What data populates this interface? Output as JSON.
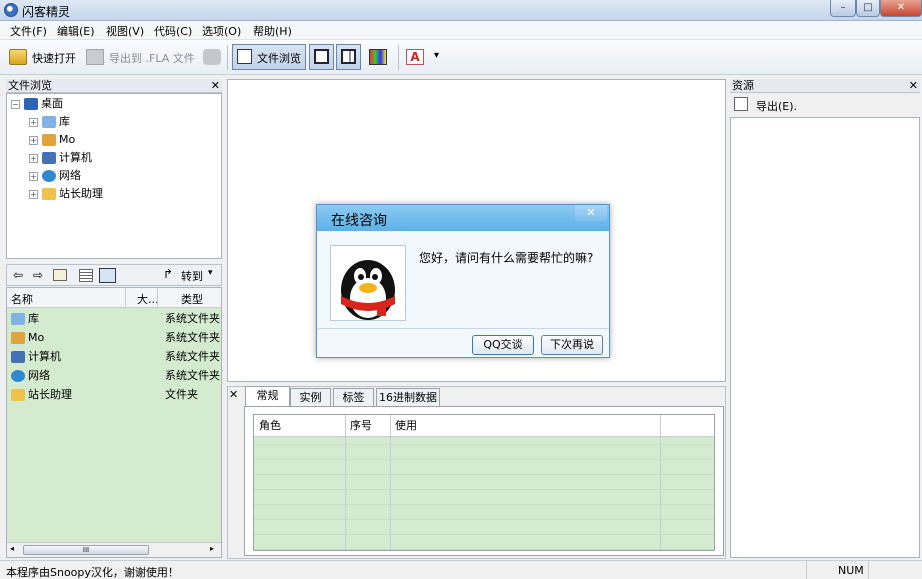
{
  "window": {
    "title": "闪客精灵",
    "controls": {
      "minimize": "–",
      "maximize": "□",
      "close": "✕"
    }
  },
  "menu": [
    "文件(F)",
    "编辑(E)",
    "视图(V)",
    "代码(C)",
    "选项(O)",
    "帮助(H)"
  ],
  "toolbar": {
    "quick_open": "快速打开",
    "export_fla": "导出到 .FLA 文件",
    "file_browse": "文件浏览",
    "dropdown_arrow": "▾"
  },
  "file_browser": {
    "title": "文件浏览",
    "close": "✕",
    "tree": {
      "root": "桌面",
      "items": [
        {
          "label": "库",
          "icon": "library-icon"
        },
        {
          "label": "Mo",
          "icon": "user-folder-icon"
        },
        {
          "label": "计算机",
          "icon": "computer-icon"
        },
        {
          "label": "网络",
          "icon": "network-icon"
        },
        {
          "label": "站长助理",
          "icon": "folder-icon"
        }
      ]
    },
    "nav": {
      "goto": "转到",
      "goto_arrow": "▾"
    },
    "columns": [
      "名称",
      "大...",
      "类型"
    ],
    "files": [
      {
        "name": "库",
        "type": "系统文件夹",
        "icon": "library-icon"
      },
      {
        "name": "Mo",
        "type": "系统文件夹",
        "icon": "user-folder-icon"
      },
      {
        "name": "计算机",
        "type": "系统文件夹",
        "icon": "computer-icon"
      },
      {
        "name": "网络",
        "type": "系统文件夹",
        "icon": "network-icon"
      },
      {
        "name": "站长助理",
        "type": "文件夹",
        "icon": "folder-icon"
      }
    ],
    "hscroll_thumb": "III"
  },
  "resources": {
    "title": "资源",
    "close": "✕",
    "export": "导出(E)."
  },
  "dialog": {
    "title": "在线咨询",
    "close": "✕",
    "message": "您好，请问有什么需要帮忙的嘛?",
    "ok_button": "QQ交谈",
    "later_button": "下次再说"
  },
  "bottom_panel": {
    "close": "✕",
    "tabs": [
      "常规",
      "实例",
      "标签",
      "16进制数据"
    ],
    "active_tab": "常规",
    "columns": [
      "角色",
      "序号",
      "使用"
    ]
  },
  "status": {
    "text": "本程序由Snoopy汉化，谢谢使用！",
    "num": "NUM"
  }
}
